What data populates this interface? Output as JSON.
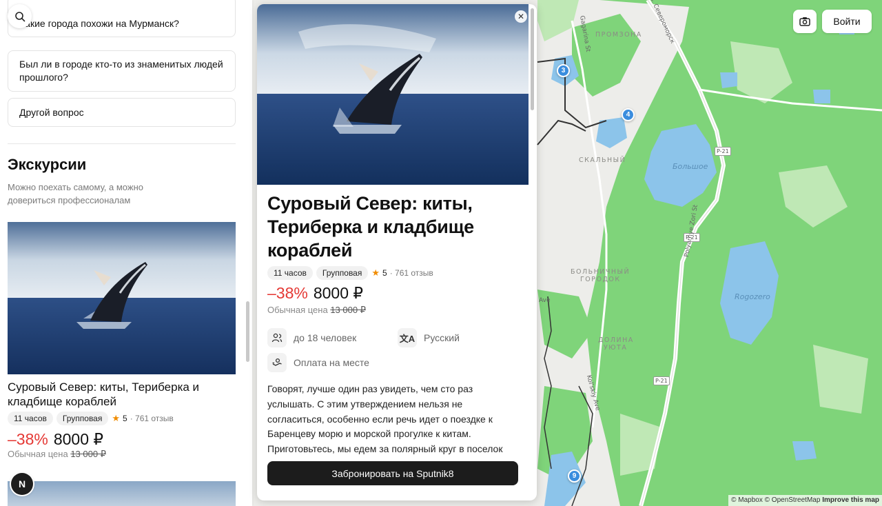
{
  "questions": [
    {
      "label": "Какие города похожи на Мурманск?"
    },
    {
      "label": "Был ли в городе кто-то из знаменитых людей прошлого?"
    },
    {
      "label": "Другой вопрос"
    }
  ],
  "excursions": {
    "heading": "Экскурсии",
    "subtitle": "Можно поехать самому, а можно довериться профессионалам"
  },
  "tour": {
    "title": "Суровый Север: киты, Териберка и кладбище кораблей",
    "duration": "11 часов",
    "type": "Групповая",
    "rating": "5",
    "reviews": "· 761 отзыв",
    "discount": "–38%",
    "price": "8000 ₽",
    "old_price_label": "Обычная цена",
    "old_price": "13 000 ₽",
    "group_size": "до 18 человек",
    "language": "Русский",
    "payment": "Оплата на месте",
    "description": "Говорят, лучше один раз увидеть, чем сто раз услышать. С этим утверждением нельзя не согласиться, особенно если речь идет о поездке к Баренцеву морю и морской прогулке к китам. Приготовьтесь, мы едем за полярный круг в поселок Териберка. Отсюда мы выйдем в",
    "book_label": "Забронировать на Sputnik8",
    "close_icon": "close-icon"
  },
  "avatar_letter": "N",
  "header": {
    "login_label": "Войти",
    "camera_icon": "camera-icon"
  },
  "map": {
    "labels": [
      "ПРОМЗОНА",
      "СКАЛЬНЫЙ",
      "БОЛЬНИЧНЫЙ",
      "ГОРОДОК",
      "ДОЛИНА",
      "УЮТА"
    ],
    "lakes": [
      "Большое",
      "Rogozero"
    ],
    "roads": [
      "P-21",
      "P-21",
      "P-21"
    ],
    "streets": [
      "Gagarina St",
      "ул. Североморск",
      "Polyarnye Zori St",
      "Kol'skiy Ave",
      "Ave"
    ],
    "pins": [
      "3",
      "4",
      "9"
    ],
    "attribution": {
      "mapbox": "© Mapbox",
      "osm": "© OpenStreetMap",
      "improve": "Improve this map"
    }
  },
  "colors": {
    "discount": "#e53935",
    "accent_pin": "#3a8dde",
    "forest": "#7fd47a",
    "water": "#8cc4ea",
    "button_dark": "#1c1c1c"
  }
}
